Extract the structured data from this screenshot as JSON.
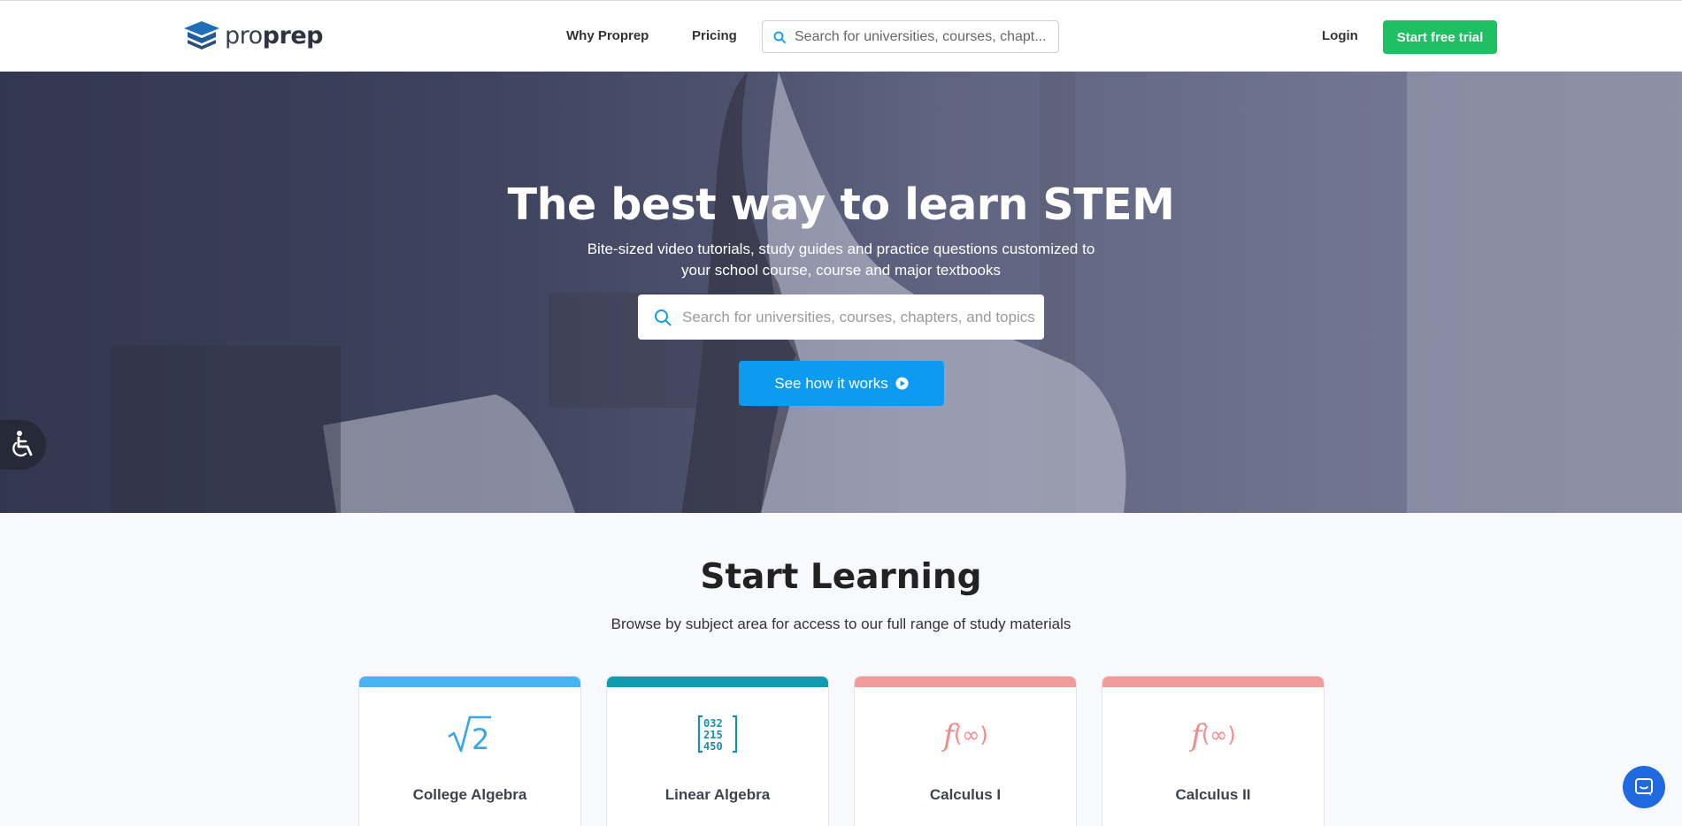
{
  "header": {
    "logo_prefix": "pro",
    "logo_suffix": "prep",
    "nav": [
      {
        "label": "Why Proprep"
      },
      {
        "label": "Pricing"
      }
    ],
    "search_placeholder": "Search for universities, courses, chapt...",
    "login_label": "Login",
    "trial_label": "Start free trial"
  },
  "hero": {
    "title": "The best way to learn STEM",
    "subtitle": "Bite-sized video tutorials, study guides and practice questions customized to your school course, course and major textbooks",
    "search_placeholder": "Search for universities, courses, chapters, and topics",
    "cta_label": "See how it works",
    "cta_icon": "play-circle-icon",
    "accessibility_icon": "wheelchair-icon"
  },
  "start_learning": {
    "title": "Start Learning",
    "subtitle": "Browse by subject area for access to our full range of study materials",
    "cards": [
      {
        "label": "College Algebra",
        "icon": "square-root-icon",
        "bar_color": "#4ab3f4",
        "icon_color": "#3aa6ea"
      },
      {
        "label": "Linear Algebra",
        "icon": "matrix-icon",
        "bar_color": "#0f9bb0",
        "icon_color": "#1a8fa8"
      },
      {
        "label": "Calculus I",
        "icon": "function-icon",
        "bar_color": "#f29b9b",
        "icon_color": "#ee8c8c"
      },
      {
        "label": "Calculus II",
        "icon": "function-icon",
        "bar_color": "#f29b9b",
        "icon_color": "#ee8c8c"
      }
    ]
  },
  "colors": {
    "brand_green": "#1fbf63",
    "cta_blue": "#0d9bf2",
    "chat_blue": "#1f6ae0"
  }
}
